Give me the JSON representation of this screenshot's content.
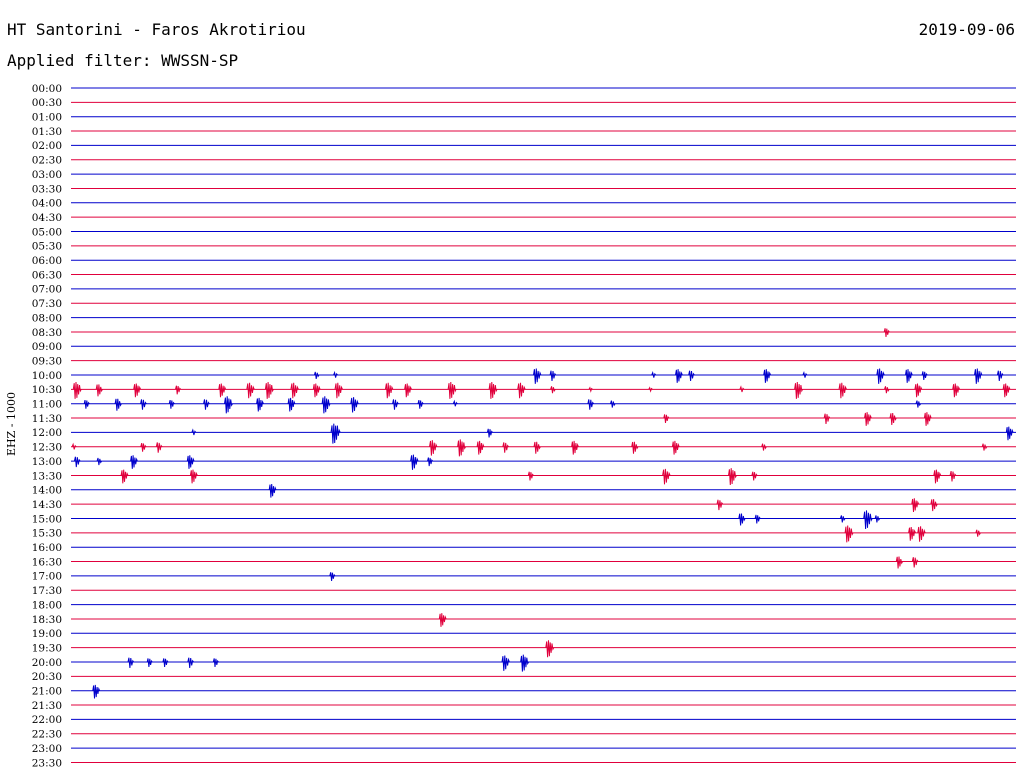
{
  "header": {
    "station": "HT Santorini - Faros Akrotiriou",
    "filter_label": "Applied filter: WWSSN-SP",
    "date": "2019-09-06"
  },
  "chart_data": {
    "type": "seismogram (helicorder)",
    "channel_label": "EHZ - 1000",
    "row_colors": [
      "#0000cc",
      "#e0003c"
    ],
    "time_labels": [
      "00:00",
      "00:30",
      "01:00",
      "01:30",
      "02:00",
      "02:30",
      "03:00",
      "03:30",
      "04:00",
      "04:30",
      "05:00",
      "05:30",
      "06:00",
      "06:30",
      "07:00",
      "07:30",
      "08:00",
      "08:30",
      "09:00",
      "09:30",
      "10:00",
      "10:30",
      "11:00",
      "11:30",
      "12:00",
      "12:30",
      "13:00",
      "13:30",
      "14:00",
      "14:30",
      "15:00",
      "15:30",
      "16:00",
      "16:30",
      "17:00",
      "17:30",
      "18:00",
      "18:30",
      "19:00",
      "19:30",
      "20:00",
      "20:30",
      "21:00",
      "21:30",
      "22:00",
      "22:30",
      "23:00",
      "23:30"
    ],
    "x_unit": "minutes after row start",
    "xlim": [
      0,
      30
    ],
    "events": [
      {
        "row": "08:30",
        "minute": 25.9,
        "amplitude": 5
      },
      {
        "row": "10:00",
        "minute": 7.8,
        "amplitude": 4
      },
      {
        "row": "10:00",
        "minute": 8.4,
        "amplitude": 3
      },
      {
        "row": "10:00",
        "minute": 14.8,
        "amplitude": 9
      },
      {
        "row": "10:00",
        "minute": 15.3,
        "amplitude": 6
      },
      {
        "row": "10:00",
        "minute": 18.5,
        "amplitude": 3
      },
      {
        "row": "10:00",
        "minute": 19.3,
        "amplitude": 8
      },
      {
        "row": "10:00",
        "minute": 19.7,
        "amplitude": 6
      },
      {
        "row": "10:00",
        "minute": 22.1,
        "amplitude": 8
      },
      {
        "row": "10:00",
        "minute": 23.3,
        "amplitude": 3
      },
      {
        "row": "10:00",
        "minute": 25.7,
        "amplitude": 9
      },
      {
        "row": "10:00",
        "minute": 26.6,
        "amplitude": 8
      },
      {
        "row": "10:00",
        "minute": 27.1,
        "amplitude": 5
      },
      {
        "row": "10:00",
        "minute": 28.8,
        "amplitude": 9
      },
      {
        "row": "10:00",
        "minute": 29.5,
        "amplitude": 6
      },
      {
        "row": "10:30",
        "minute": 0.2,
        "amplitude": 10
      },
      {
        "row": "10:30",
        "minute": 0.9,
        "amplitude": 7
      },
      {
        "row": "10:30",
        "minute": 2.1,
        "amplitude": 8
      },
      {
        "row": "10:30",
        "minute": 3.4,
        "amplitude": 5
      },
      {
        "row": "10:30",
        "minute": 4.8,
        "amplitude": 8
      },
      {
        "row": "10:30",
        "minute": 5.7,
        "amplitude": 9
      },
      {
        "row": "10:30",
        "minute": 6.3,
        "amplitude": 10
      },
      {
        "row": "10:30",
        "minute": 7.1,
        "amplitude": 9
      },
      {
        "row": "10:30",
        "minute": 7.8,
        "amplitude": 8
      },
      {
        "row": "10:30",
        "minute": 8.5,
        "amplitude": 9
      },
      {
        "row": "10:30",
        "minute": 10.1,
        "amplitude": 9
      },
      {
        "row": "10:30",
        "minute": 10.7,
        "amplitude": 8
      },
      {
        "row": "10:30",
        "minute": 12.1,
        "amplitude": 10
      },
      {
        "row": "10:30",
        "minute": 13.4,
        "amplitude": 10
      },
      {
        "row": "10:30",
        "minute": 14.3,
        "amplitude": 9
      },
      {
        "row": "10:30",
        "minute": 15.3,
        "amplitude": 4
      },
      {
        "row": "10:30",
        "minute": 16.5,
        "amplitude": 2
      },
      {
        "row": "10:30",
        "minute": 18.4,
        "amplitude": 2
      },
      {
        "row": "10:30",
        "minute": 21.3,
        "amplitude": 3
      },
      {
        "row": "10:30",
        "minute": 23.1,
        "amplitude": 10
      },
      {
        "row": "10:30",
        "minute": 24.5,
        "amplitude": 9
      },
      {
        "row": "10:30",
        "minute": 25.9,
        "amplitude": 4
      },
      {
        "row": "10:30",
        "minute": 26.9,
        "amplitude": 8
      },
      {
        "row": "10:30",
        "minute": 28.1,
        "amplitude": 8
      },
      {
        "row": "10:30",
        "minute": 29.7,
        "amplitude": 8
      },
      {
        "row": "11:00",
        "minute": 0.5,
        "amplitude": 5
      },
      {
        "row": "11:00",
        "minute": 1.5,
        "amplitude": 7
      },
      {
        "row": "11:00",
        "minute": 2.3,
        "amplitude": 6
      },
      {
        "row": "11:00",
        "minute": 3.2,
        "amplitude": 5
      },
      {
        "row": "11:00",
        "minute": 4.3,
        "amplitude": 6
      },
      {
        "row": "11:00",
        "minute": 5.0,
        "amplitude": 10
      },
      {
        "row": "11:00",
        "minute": 6.0,
        "amplitude": 8
      },
      {
        "row": "11:00",
        "minute": 7.0,
        "amplitude": 8
      },
      {
        "row": "11:00",
        "minute": 8.1,
        "amplitude": 10
      },
      {
        "row": "11:00",
        "minute": 9.0,
        "amplitude": 9
      },
      {
        "row": "11:00",
        "minute": 10.3,
        "amplitude": 6
      },
      {
        "row": "11:00",
        "minute": 11.1,
        "amplitude": 5
      },
      {
        "row": "11:00",
        "minute": 12.2,
        "amplitude": 3
      },
      {
        "row": "11:00",
        "minute": 16.5,
        "amplitude": 6
      },
      {
        "row": "11:00",
        "minute": 17.2,
        "amplitude": 4
      },
      {
        "row": "11:00",
        "minute": 26.9,
        "amplitude": 4
      },
      {
        "row": "11:30",
        "minute": 18.9,
        "amplitude": 5
      },
      {
        "row": "11:30",
        "minute": 24.0,
        "amplitude": 6
      },
      {
        "row": "11:30",
        "minute": 25.3,
        "amplitude": 8
      },
      {
        "row": "11:30",
        "minute": 26.1,
        "amplitude": 7
      },
      {
        "row": "11:30",
        "minute": 27.2,
        "amplitude": 8
      },
      {
        "row": "12:00",
        "minute": 3.9,
        "amplitude": 3
      },
      {
        "row": "12:00",
        "minute": 8.4,
        "amplitude": 12
      },
      {
        "row": "12:00",
        "minute": 13.3,
        "amplitude": 5
      },
      {
        "row": "12:00",
        "minute": 29.8,
        "amplitude": 8
      },
      {
        "row": "12:30",
        "minute": 0.1,
        "amplitude": 3
      },
      {
        "row": "12:30",
        "minute": 2.3,
        "amplitude": 5
      },
      {
        "row": "12:30",
        "minute": 2.8,
        "amplitude": 6
      },
      {
        "row": "12:30",
        "minute": 11.5,
        "amplitude": 9
      },
      {
        "row": "12:30",
        "minute": 12.4,
        "amplitude": 10
      },
      {
        "row": "12:30",
        "minute": 13.0,
        "amplitude": 8
      },
      {
        "row": "12:30",
        "minute": 13.8,
        "amplitude": 6
      },
      {
        "row": "12:30",
        "minute": 14.8,
        "amplitude": 7
      },
      {
        "row": "12:30",
        "minute": 16.0,
        "amplitude": 8
      },
      {
        "row": "12:30",
        "minute": 17.9,
        "amplitude": 7
      },
      {
        "row": "12:30",
        "minute": 19.2,
        "amplitude": 8
      },
      {
        "row": "12:30",
        "minute": 22.0,
        "amplitude": 4
      },
      {
        "row": "12:30",
        "minute": 29.0,
        "amplitude": 4
      },
      {
        "row": "13:00",
        "minute": 0.2,
        "amplitude": 6
      },
      {
        "row": "13:00",
        "minute": 0.9,
        "amplitude": 4
      },
      {
        "row": "13:00",
        "minute": 2.0,
        "amplitude": 8
      },
      {
        "row": "13:00",
        "minute": 3.8,
        "amplitude": 8
      },
      {
        "row": "13:00",
        "minute": 10.9,
        "amplitude": 9
      },
      {
        "row": "13:00",
        "minute": 11.4,
        "amplitude": 5
      },
      {
        "row": "13:30",
        "minute": 1.7,
        "amplitude": 8
      },
      {
        "row": "13:30",
        "minute": 3.9,
        "amplitude": 8
      },
      {
        "row": "13:30",
        "minute": 14.6,
        "amplitude": 5
      },
      {
        "row": "13:30",
        "minute": 18.9,
        "amplitude": 9
      },
      {
        "row": "13:30",
        "minute": 21.0,
        "amplitude": 10
      },
      {
        "row": "13:30",
        "minute": 21.7,
        "amplitude": 5
      },
      {
        "row": "13:30",
        "minute": 27.5,
        "amplitude": 8
      },
      {
        "row": "13:30",
        "minute": 28.0,
        "amplitude": 6
      },
      {
        "row": "14:00",
        "minute": 6.4,
        "amplitude": 8
      },
      {
        "row": "14:30",
        "minute": 20.6,
        "amplitude": 6
      },
      {
        "row": "14:30",
        "minute": 26.8,
        "amplitude": 8
      },
      {
        "row": "14:30",
        "minute": 27.4,
        "amplitude": 7
      },
      {
        "row": "15:00",
        "minute": 21.3,
        "amplitude": 7
      },
      {
        "row": "15:00",
        "minute": 21.8,
        "amplitude": 5
      },
      {
        "row": "15:00",
        "minute": 24.5,
        "amplitude": 4
      },
      {
        "row": "15:00",
        "minute": 25.3,
        "amplitude": 11
      },
      {
        "row": "15:00",
        "minute": 25.6,
        "amplitude": 4
      },
      {
        "row": "15:30",
        "minute": 24.7,
        "amplitude": 10
      },
      {
        "row": "15:30",
        "minute": 26.7,
        "amplitude": 8
      },
      {
        "row": "15:30",
        "minute": 27.0,
        "amplitude": 9
      },
      {
        "row": "15:30",
        "minute": 28.8,
        "amplitude": 4
      },
      {
        "row": "16:30",
        "minute": 26.3,
        "amplitude": 7
      },
      {
        "row": "16:30",
        "minute": 26.8,
        "amplitude": 6
      },
      {
        "row": "17:00",
        "minute": 8.3,
        "amplitude": 5
      },
      {
        "row": "18:30",
        "minute": 11.8,
        "amplitude": 8
      },
      {
        "row": "19:30",
        "minute": 15.2,
        "amplitude": 10
      },
      {
        "row": "20:00",
        "minute": 1.9,
        "amplitude": 6
      },
      {
        "row": "20:00",
        "minute": 2.5,
        "amplitude": 5
      },
      {
        "row": "20:00",
        "minute": 3.0,
        "amplitude": 5
      },
      {
        "row": "20:00",
        "minute": 3.8,
        "amplitude": 6
      },
      {
        "row": "20:00",
        "minute": 4.6,
        "amplitude": 5
      },
      {
        "row": "20:00",
        "minute": 13.8,
        "amplitude": 9
      },
      {
        "row": "20:00",
        "minute": 14.4,
        "amplitude": 10
      },
      {
        "row": "21:00",
        "minute": 0.8,
        "amplitude": 8
      }
    ]
  }
}
